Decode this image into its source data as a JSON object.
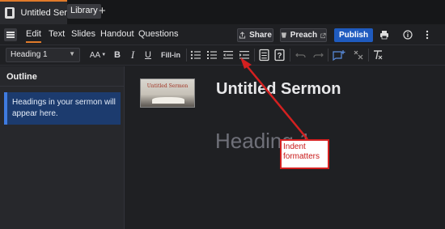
{
  "tabs": {
    "active_title": "Untitled Sermon",
    "library_label": "Library",
    "add_label": "+"
  },
  "menu": {
    "items": [
      "Edit",
      "Text",
      "Slides",
      "Handout",
      "Questions"
    ],
    "active_item": "Edit",
    "share_label": "Share",
    "preach_label": "Preach",
    "publish_label": "Publish"
  },
  "toolbar": {
    "style_value": "Heading 1",
    "font_size_label": "AA",
    "bold_label": "B",
    "italic_label": "I",
    "underline_label": "U",
    "fill_in_label": "Fill-in"
  },
  "sidebar": {
    "title": "Outline",
    "empty_message": "Headings in your sermon will appear here."
  },
  "editor": {
    "thumbnail_text": "Untitled Sermon",
    "document_title": "Untitled Sermon",
    "heading_placeholder": "Heading 1"
  },
  "annotation": {
    "text": "Indent formatters"
  },
  "colors": {
    "accent": "#e07a2a",
    "publish": "#1f5bbf",
    "annotation": "#d42020"
  }
}
